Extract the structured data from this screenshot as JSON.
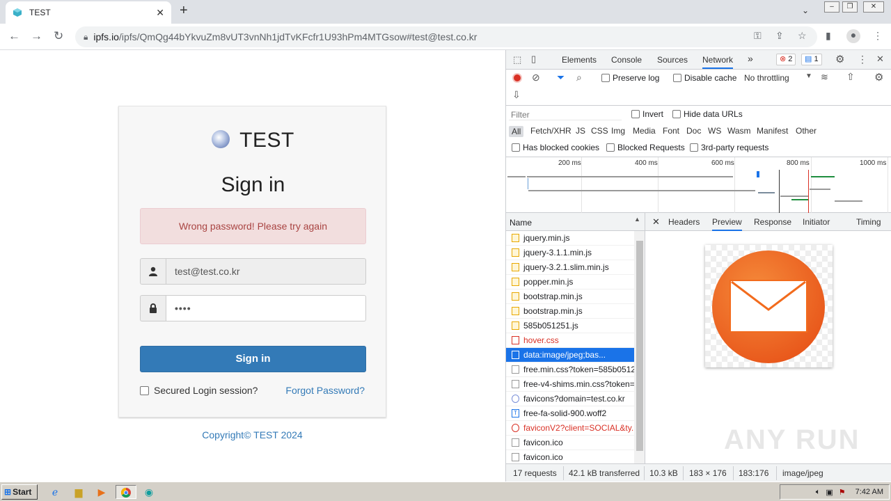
{
  "browser": {
    "tab_title": "TEST",
    "tab_close": "✕",
    "new_tab": "+",
    "url_host": "ipfs.io",
    "url_path": "/ipfs/QmQg44bYkvuZm8vUT3vnNh1jdTvKFcfr1U93hPm4MTGsow#test@test.co.kr"
  },
  "page": {
    "brand": "TEST",
    "heading": "Sign in",
    "alert": "Wrong password! Please try again",
    "email_value": "test@test.co.kr",
    "password_value": "••••",
    "submit_label": "Sign in",
    "secured_label": "Secured Login session?",
    "forgot_label": "Forgot Password?",
    "copyright": "Copyright© TEST 2024"
  },
  "devtools": {
    "tabs": [
      "Elements",
      "Console",
      "Sources",
      "Network"
    ],
    "active_tab": "Network",
    "more": "»",
    "error_count": "2",
    "message_count": "1",
    "preserve_log": "Preserve log",
    "disable_cache": "Disable cache",
    "throttling": "No throttling",
    "filter_placeholder": "Filter",
    "invert": "Invert",
    "hide_data_urls": "Hide data URLs",
    "types": [
      "All",
      "Fetch/XHR",
      "JS",
      "CSS",
      "Img",
      "Media",
      "Font",
      "Doc",
      "WS",
      "Wasm",
      "Manifest",
      "Other"
    ],
    "has_blocked_cookies": "Has blocked cookies",
    "blocked_requests": "Blocked Requests",
    "third_party": "3rd-party requests",
    "ticks": [
      "200 ms",
      "400 ms",
      "600 ms",
      "800 ms",
      "1000 ms"
    ],
    "name_header": "Name",
    "requests": [
      {
        "name": "jquery.min.js",
        "kind": "js"
      },
      {
        "name": "jquery-3.1.1.min.js",
        "kind": "js"
      },
      {
        "name": "jquery-3.2.1.slim.min.js",
        "kind": "js"
      },
      {
        "name": "popper.min.js",
        "kind": "js"
      },
      {
        "name": "bootstrap.min.js",
        "kind": "js"
      },
      {
        "name": "bootstrap.min.js",
        "kind": "js"
      },
      {
        "name": "585b051251.js",
        "kind": "js"
      },
      {
        "name": "hover.css",
        "kind": "css-err"
      },
      {
        "name": "data:image/jpeg;bas...",
        "kind": "img-sel"
      },
      {
        "name": "free.min.css?token=585b0512",
        "kind": "doc"
      },
      {
        "name": "free-v4-shims.min.css?token=",
        "kind": "doc"
      },
      {
        "name": "favicons?domain=test.co.kr",
        "kind": "img"
      },
      {
        "name": "free-fa-solid-900.woff2",
        "kind": "font"
      },
      {
        "name": "faviconV2?client=SOCIAL&ty..",
        "kind": "img-err"
      },
      {
        "name": "favicon.ico",
        "kind": "doc"
      },
      {
        "name": "favicon.ico",
        "kind": "doc"
      }
    ],
    "preview_tabs": [
      "Headers",
      "Preview",
      "Response",
      "Initiator",
      "Timing"
    ],
    "active_preview_tab": "Preview",
    "status_requests": "17 requests",
    "status_transferred": "42.1 kB transferred",
    "img_size": "10.3 kB",
    "img_dims": "183 × 176",
    "img_ratio": "183:176",
    "img_type": "image/jpeg"
  },
  "taskbar": {
    "start": "Start",
    "clock": "7:42 AM"
  },
  "watermark": "ANY RUN",
  "colors": {
    "accent": "#1a73e8",
    "signin_button": "#337ab7",
    "alert_bg": "#f2dede",
    "alert_text": "#a94442",
    "mail_icon_orange": "#f26b1d"
  }
}
